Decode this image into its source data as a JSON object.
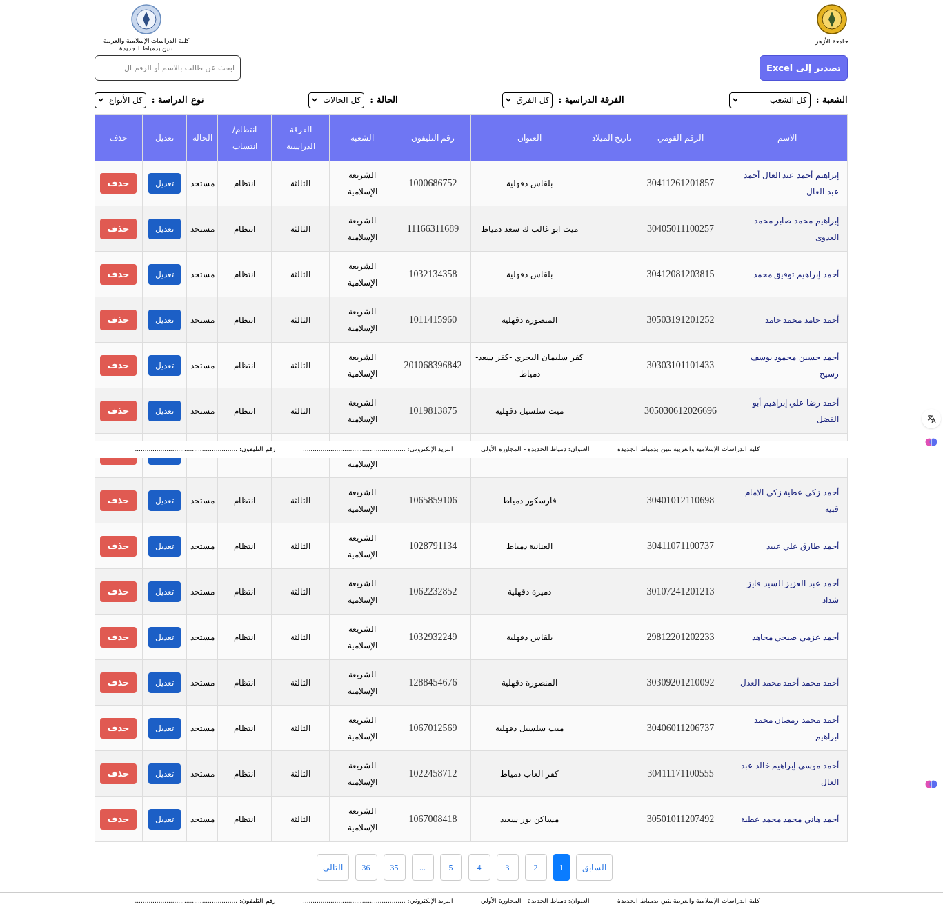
{
  "header": {
    "college_name": "كلية الدراسات الإسلامية والعربية",
    "college_branch": "بنين بدمياط الجديدة",
    "university_name": "جامعة الأزهر"
  },
  "search": {
    "placeholder": "ابحث عن طالب بالاسم أو الرقم ال"
  },
  "export_button": "تصدير إلى Excel",
  "filters": [
    {
      "label": "الشعبة :",
      "value": "كل الشعب"
    },
    {
      "label": "الفرقة الدراسية :",
      "value": "كل الفرق"
    },
    {
      "label": "الحالة :",
      "value": "كل الحالات"
    },
    {
      "label": "نوع الدراسة :",
      "value": "كل الأنواع"
    }
  ],
  "table": {
    "columns": [
      "الاسم",
      "الرقم القومي",
      "تاريخ الميلاد",
      "العنوان",
      "رقم التليفون",
      "الشعبة",
      "الفرقة الدراسية",
      "انتظام/ انتساب",
      "الحالة",
      "تعديل",
      "حذف"
    ],
    "rows": [
      {
        "kind": "full",
        "name": "إبراهيم أحمد عبد العال أحمد عبد العال",
        "national_id": "30411261201857",
        "address": "بلقاس دقهلية",
        "phone": "1000686752",
        "department": "الشريعة الإسلامية",
        "year": "الثالثة",
        "study_type": "انتظام",
        "status": "مستجد",
        "edit": "تعديل",
        "delete": "حذف"
      },
      {
        "kind": "full",
        "name": "إبراهيم محمد صابر محمد العدوى",
        "national_id": "30405011100257",
        "address": "ميت ابو غالب ك سعد دمياط",
        "phone": "11166311689",
        "department": "الشريعة الإسلامية",
        "year": "الثالثة",
        "study_type": "انتظام",
        "status": "مستجد",
        "edit": "تعديل",
        "delete": "حذف"
      },
      {
        "kind": "full",
        "name": "أحمد إبراهيم توفيق محمد",
        "national_id": "30412081203815",
        "address": "بلقاس دقهلية",
        "phone": "1032134358",
        "department": "الشريعة الإسلامية",
        "year": "الثالثة",
        "study_type": "انتظام",
        "status": "مستجد",
        "edit": "تعديل",
        "delete": "حذف"
      },
      {
        "kind": "full",
        "name": "أحمد حامد محمد حامد",
        "national_id": "30503191201252",
        "address": "المنصورة دقهلية",
        "phone": "1011415960",
        "department": "الشريعة الإسلامية",
        "year": "الثالثة",
        "study_type": "انتظام",
        "status": "مستجد",
        "edit": "تعديل",
        "delete": "حذف"
      },
      {
        "kind": "full",
        "name": "أحمد حسين محمود يوسف رسيح",
        "national_id": "30303101101433",
        "address": "كفر سليمان البحري -كفر سعد- دمياط",
        "phone": "201068396842",
        "department": "الشريعة الإسلامية",
        "year": "الثالثة",
        "study_type": "انتظام",
        "status": "مستجد",
        "edit": "تعديل",
        "delete": "حذف"
      },
      {
        "kind": "full",
        "name": "أحمد رضا علي إبراهيم أبو الفضل",
        "national_id": "305030612026696",
        "address": "ميت سلسيل دقهلية",
        "phone": "1019813875",
        "department": "الشريعة الإسلامية",
        "year": "الثالثة",
        "study_type": "انتظام",
        "status": "مستجد",
        "edit": "تعديل",
        "delete": "حذف"
      },
      {
        "kind": "cut",
        "department": "الإسلامية"
      },
      {
        "kind": "full",
        "name": "أحمد زكي عطية زكي الامام قبية",
        "national_id": "30401012110698",
        "address": "فارسكور دمياط",
        "phone": "1065859106",
        "department": "الشريعة الإسلامية",
        "year": "الثالثة",
        "study_type": "انتظام",
        "status": "مستجد",
        "edit": "تعديل",
        "delete": "حذف"
      },
      {
        "kind": "full",
        "name": "أحمد طارق علي عبيد",
        "national_id": "30411071100737",
        "address": "العنانية دمياط",
        "phone": "1028791134",
        "department": "الشريعة الإسلامية",
        "year": "الثالثة",
        "study_type": "انتظام",
        "status": "مستجد",
        "edit": "تعديل",
        "delete": "حذف"
      },
      {
        "kind": "full",
        "name": "أحمد عبد العزيز السيد فايز شداد",
        "national_id": "30107241201213",
        "address": "دميرة دقهلية",
        "phone": "1062232852",
        "department": "الشريعة الإسلامية",
        "year": "الثالثة",
        "study_type": "انتظام",
        "status": "مستجد",
        "edit": "تعديل",
        "delete": "حذف"
      },
      {
        "kind": "full",
        "name": "أحمد عزمي صبحي مجاهد",
        "national_id": "29812201202233",
        "address": "بلقاس دقهلية",
        "phone": "1032932249",
        "department": "الشريعة الإسلامية",
        "year": "الثالثة",
        "study_type": "انتظام",
        "status": "مستجد",
        "edit": "تعديل",
        "delete": "حذف"
      },
      {
        "kind": "full",
        "name": "أحمد محمد أحمد محمد العدل",
        "national_id": "30309201210092",
        "address": "المنصورة دقهلية",
        "phone": "1288454676",
        "department": "الشريعة الإسلامية",
        "year": "الثالثة",
        "study_type": "انتظام",
        "status": "مستجد",
        "edit": "تعديل",
        "delete": "حذف"
      },
      {
        "kind": "full",
        "name": "أحمد محمد رمضان محمد ابراهيم",
        "national_id": "30406011206737",
        "address": "ميت سلسيل دقهلية",
        "phone": "1067012569",
        "department": "الشريعة الإسلامية",
        "year": "الثالثة",
        "study_type": "انتظام",
        "status": "مستجد",
        "edit": "تعديل",
        "delete": "حذف"
      },
      {
        "kind": "full",
        "name": "أحمد موسى إبراهيم خالد عبد العال",
        "national_id": "30411171100555",
        "address": "كفر الغاب دمياط",
        "phone": "1022458712",
        "department": "الشريعة الإسلامية",
        "year": "الثالثة",
        "study_type": "انتظام",
        "status": "مستجد",
        "edit": "تعديل",
        "delete": "حذف"
      },
      {
        "kind": "full",
        "name": "أحمد هاني محمد محمد عطية",
        "national_id": "30501011207492",
        "address": "مساكن بور سعيد",
        "phone": "1067008418",
        "department": "الشريعة الإسلامية",
        "year": "الثالثة",
        "study_type": "انتظام",
        "status": "مستجد",
        "edit": "تعديل",
        "delete": "حذف"
      }
    ]
  },
  "pagination": [
    {
      "label": "السابق",
      "selected": false
    },
    {
      "label": "1",
      "selected": true
    },
    {
      "label": "2",
      "selected": false
    },
    {
      "label": "3",
      "selected": false
    },
    {
      "label": "4",
      "selected": false
    },
    {
      "label": "5",
      "selected": false
    },
    {
      "label": "...",
      "selected": false
    },
    {
      "label": "35",
      "selected": false
    },
    {
      "label": "36",
      "selected": false
    },
    {
      "label": "التالي",
      "selected": false
    }
  ],
  "print_footers": [
    {
      "college": "كلية الدراسات الإسلامية والعربية بنين بدمياط الجديدة",
      "address": "العنوان: دمياط الجديدة - المجاورة الأولي",
      "email": "البريد الإلكتروني: ....................................................",
      "phone": "رقم التليفون: ...................................................."
    },
    {
      "college": "كلية الدراسات الإسلامية والعربية بنين بدمياط الجديدة",
      "address": "العنوان: دمياط الجديدة - المجاورة الأولي",
      "email": "البريد الإلكتروني: ....................................................",
      "phone": "رقم التليفون: ...................................................."
    }
  ]
}
